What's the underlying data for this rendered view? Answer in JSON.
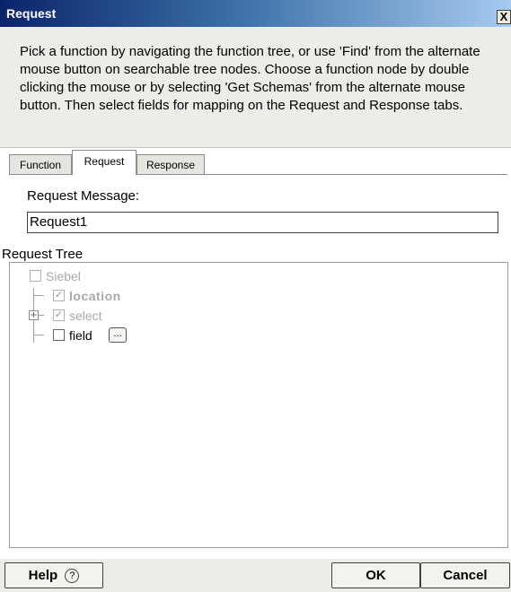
{
  "window": {
    "title": "Request",
    "close_glyph": "X"
  },
  "instructions": "Pick a function by navigating the function tree, or use 'Find' from the alternate mouse button on searchable tree nodes. Choose a function node by double clicking the mouse or by selecting 'Get Schemas' from the alternate mouse button. Then select fields for mapping on the Request and Response tabs.",
  "tabs": [
    {
      "label": "Function",
      "active": false
    },
    {
      "label": "Request",
      "active": true
    },
    {
      "label": "Response",
      "active": false
    }
  ],
  "request_message": {
    "label": "Request Message:",
    "value": "Request1"
  },
  "tree": {
    "label": "Request Tree",
    "nodes": [
      {
        "label": "Siebel",
        "checked": false,
        "disabled": true
      },
      {
        "label": "location",
        "checked": true,
        "disabled": true
      },
      {
        "label": "select",
        "checked": true,
        "disabled": true,
        "expander": "+"
      },
      {
        "label": "field",
        "checked": false,
        "disabled": false,
        "button": "..."
      }
    ]
  },
  "footer": {
    "help_label": "Help",
    "help_icon_glyph": "?",
    "ok_label": "OK",
    "cancel_label": "Cancel"
  },
  "colors": {
    "title_start": "#0a246a",
    "title_end": "#a6caf0",
    "panel_bg": "#ecece9"
  }
}
